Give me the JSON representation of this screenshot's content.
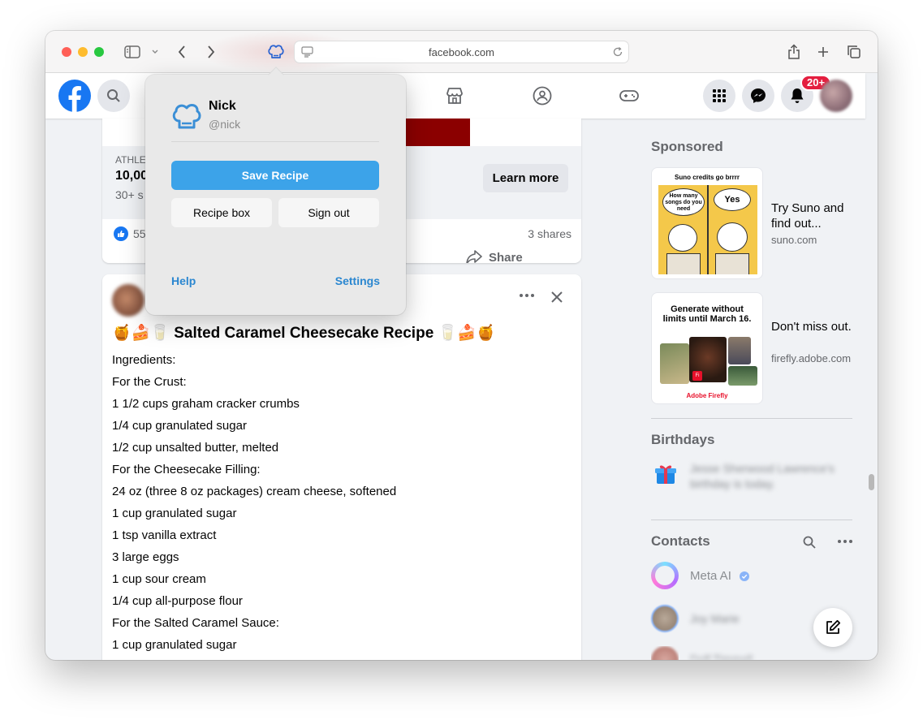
{
  "browser": {
    "url": "facebook.com",
    "traffic_colors": [
      "#ff5f57",
      "#febc2e",
      "#28c840"
    ]
  },
  "header": {
    "notifications_count": "20+"
  },
  "popup": {
    "user_name": "Nick",
    "user_handle": "@nick",
    "save_label": "Save Recipe",
    "recipe_box_label": "Recipe box",
    "sign_out_label": "Sign out",
    "help_label": "Help",
    "settings_label": "Settings",
    "accent_color": "#3ca3e9"
  },
  "ad_post": {
    "label_partial": "ATHLE",
    "headline_partial": "10,00",
    "subline_partial": "30+ s",
    "learn_more": "Learn more",
    "reactions_count": "55",
    "shares": "3 shares",
    "share_label": "Share"
  },
  "recipe_post": {
    "title": "🍯🍰🥛 Salted Caramel Cheesecake Recipe 🥛🍰🍯",
    "lines": [
      "Ingredients:",
      "For the Crust:",
      "1 1/2 cups graham cracker crumbs",
      "1/4 cup granulated sugar",
      "1/2 cup unsalted butter, melted",
      "For the Cheesecake Filling:",
      "24 oz (three 8 oz packages) cream cheese, softened",
      "1 cup granulated sugar",
      "1 tsp vanilla extract",
      "3 large eggs",
      "1 cup sour cream",
      "1/4 cup all-purpose flour",
      "For the Salted Caramel Sauce:",
      "1 cup granulated sugar"
    ]
  },
  "sidebar": {
    "sponsored_title": "Sponsored",
    "ads": [
      {
        "title": "Try Suno and find out...",
        "url": "suno.com",
        "thumb_caption": "Suno credits go brrrr",
        "bubble_left": "How many songs do you need",
        "bubble_right": "Yes"
      },
      {
        "title": "Don't miss out.",
        "url": "firefly.adobe.com",
        "thumb_caption": "Generate without limits until March 16.",
        "brand": "Adobe Firefly"
      }
    ],
    "birthdays_title": "Birthdays",
    "birthday_text": "Jesse Sherwood Lawrence's birthday is today.",
    "contacts_title": "Contacts",
    "contacts": [
      "Meta AI",
      "Joy Marie",
      "Dolf Timmell"
    ]
  }
}
